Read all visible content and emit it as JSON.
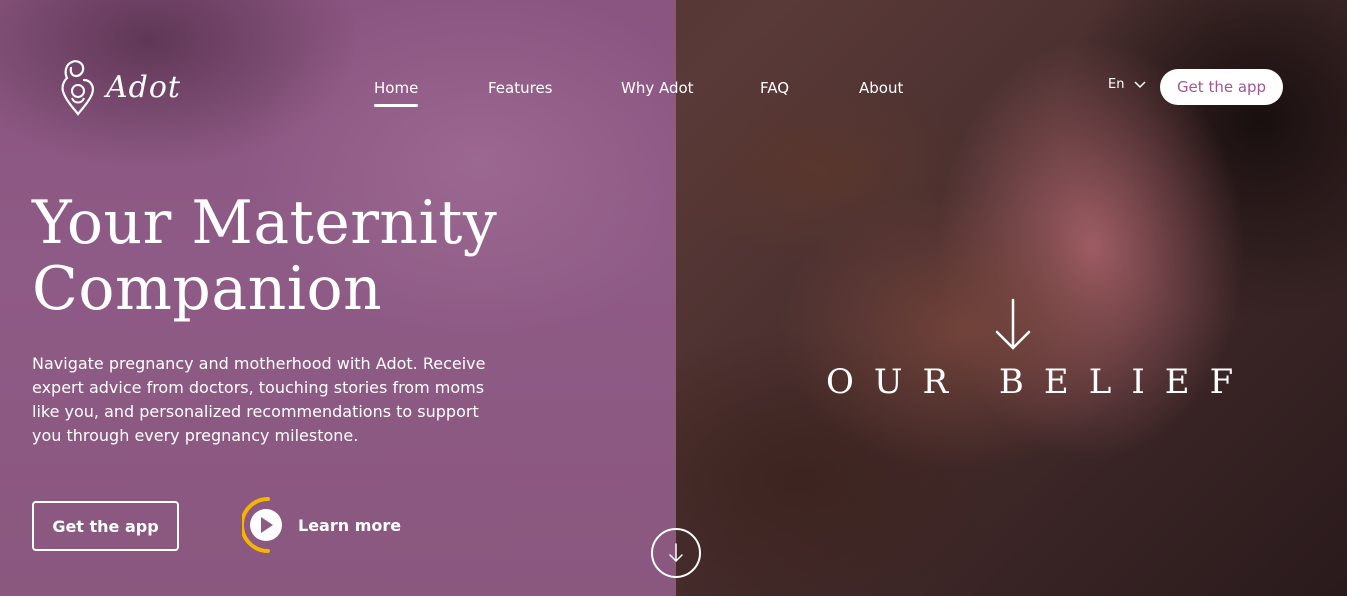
{
  "brand": {
    "name": "Adot"
  },
  "nav": {
    "items": [
      {
        "label": "Home",
        "active": true
      },
      {
        "label": "Features",
        "active": false
      },
      {
        "label": "Why Adot",
        "active": false
      },
      {
        "label": "FAQ",
        "active": false
      },
      {
        "label": "About",
        "active": false
      }
    ],
    "language": "En",
    "cta_label": "Get the app"
  },
  "hero": {
    "title_line1": "Your Maternity",
    "title_line2": "Companion",
    "subtitle": "Navigate pregnancy and motherhood with Adot. Receive expert advice from doctors, touching stories from moms like you, and personalized recommendations to support you through every pregnancy milestone.",
    "primary_cta": "Get the app",
    "secondary_cta": "Learn more"
  },
  "belief": {
    "label": "OUR BELIEF"
  },
  "colors": {
    "overlay": "#8e5b86",
    "button_text": "#a0588f",
    "accent_ring": "#f5b400"
  }
}
